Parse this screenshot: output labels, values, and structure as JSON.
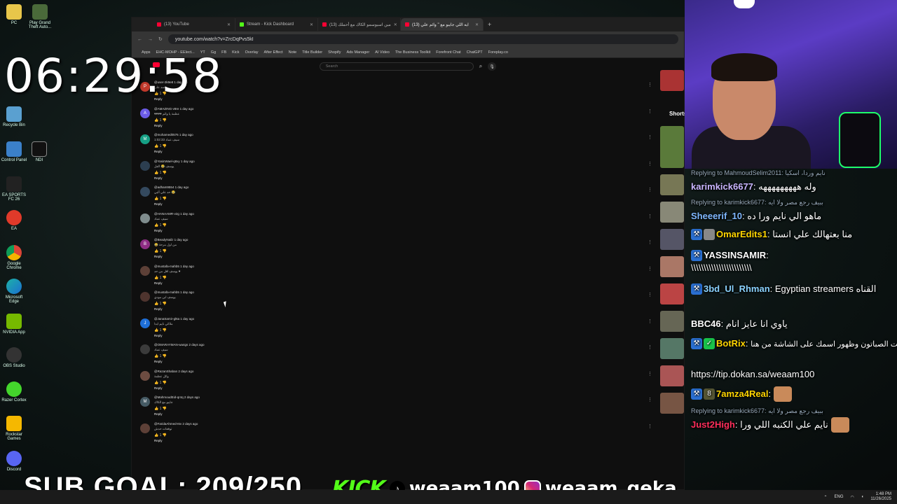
{
  "clock": "06:29:58",
  "sub_goal": "SUB GOAL: 209/250",
  "social": {
    "kick": "KICK",
    "kick_handle": "weaam100",
    "tiktok_icon": "tiktok-icon",
    "insta_handle": "weaam_geka"
  },
  "desktop_icons": [
    "PC",
    "Play Grand Theft Auto...",
    "Recycle Bin",
    "Control Panel",
    "NDI",
    "EA SPORTS FC 26",
    "EA",
    "Google Chrome",
    "Microsoft Edge",
    "NVIDIA App",
    "OBS Studio",
    "Razer Cortex",
    "Rockstar Games",
    "Discord"
  ],
  "browser": {
    "tabs": [
      {
        "label": "(13) YouTube",
        "favicon": "youtube"
      },
      {
        "label": "Stream - Kick Dashboard",
        "favicon": "kick"
      },
      {
        "label": "(13) مين اسيوسمو الكاك مع أحملك",
        "favicon": "youtube"
      },
      {
        "label": "(13) ايه اللي جايبو مع \" وائم علي",
        "favicon": "youtube"
      }
    ],
    "url": "youtube.com/watch?v=ZrcDqPvs5kI",
    "bookmarks": [
      "Apps",
      "EHC-MOHP - EElect...",
      "YT",
      "Gg",
      "FB",
      "Kick",
      "Overlay",
      "After Effect",
      "Note",
      "Title Builder",
      "Shopify",
      "Ads Manager",
      "AI Video",
      "The Business Toolkit",
      "Forefront Chat",
      "ChatGPT",
      "Foreplay.co"
    ],
    "search_placeholder": "Search",
    "shorts_label": "Shorts"
  },
  "comments": [
    {
      "avatar_color": "#c0392b",
      "initial": "P",
      "name": "@user-2k9e8 1 day ago",
      "text": "محمد علي",
      "likes": "1",
      "reply": "Reply"
    },
    {
      "avatar_color": "#6c5ce7",
      "initial": "A",
      "name": "@AMAZING-v9re 1 day ago",
      "text": "♥♥♥♥ عظمة يا وائم",
      "likes": "1",
      "reply": "Reply"
    },
    {
      "avatar_color": "#16a085",
      "initial": "M",
      "name": "@mohamed0576 1 day ago",
      "text": "سيف عماد 1:02:33",
      "likes": "1",
      "reply": "Reply"
    },
    {
      "avatar_color": "#2c3e50",
      "initial": "",
      "name": "@YasinWael-q8xy 1 day ago",
      "text": "يوسف 😂 الفل",
      "likes": "1",
      "reply": "Reply"
    },
    {
      "avatar_color": "#34495e",
      "initial": "",
      "name": "@adham9554 1 day ago",
      "text": "حد علي ألبي 😂",
      "likes": "1",
      "reply": "Reply"
    },
    {
      "avatar_color": "#7f8c8d",
      "initial": "",
      "name": "@HANAAMR-v2g 1 day ago",
      "text": "سيف عماد",
      "likes": "1",
      "reply": "Reply"
    },
    {
      "avatar_color": "#8e2d84",
      "initial": "B",
      "name": "@BeadyNailz 1 day ago",
      "text": "😂 من اول مرحة",
      "likes": "1",
      "reply": "Reply"
    },
    {
      "avatar_color": "#5d4037",
      "initial": "",
      "name": "@mustafa-mahb5 1 day ago",
      "text": "يوسف اقل من حد ♥",
      "likes": "1",
      "reply": "Reply"
    },
    {
      "avatar_color": "#4e342e",
      "initial": "",
      "name": "@mustafa-mahb5 1 day ago",
      "text": "يوسف ابن مودي",
      "likes": "1",
      "reply": "Reply"
    },
    {
      "avatar_color": "#1e6fd9",
      "initial": "J",
      "name": "@JanaSamir-gl6a 1 day ago",
      "text": "ملاكي نايم ابدا",
      "likes": "1",
      "reply": "Reply"
    },
    {
      "avatar_color": "#3b3b3b",
      "initial": "",
      "name": "@OMARAYMAN-wa4gs 2 days ago",
      "text": "سيف عماد",
      "likes": "1",
      "reply": "Reply"
    },
    {
      "avatar_color": "#6d4c41",
      "initial": "",
      "name": "@RazanShaban 2 days ago",
      "text": "وائل عظمة",
      "likes": "1",
      "reply": "Reply"
    },
    {
      "avatar_color": "#455a64",
      "initial": "M",
      "name": "@MahmoudEid-qr4q 2 days ago",
      "text": "جايبو مع الكاك",
      "likes": "1",
      "reply": "Reply"
    },
    {
      "avatar_color": "#5d4037",
      "initial": "",
      "name": "@FaridaAhmed-I6v 2 days ago",
      "text": "توقعات حدش",
      "likes": "1",
      "reply": "Reply"
    }
  ],
  "chat": [
    {
      "reply_to": "Replying to MahmoudSelim2011: نايم وردا، اسكيا",
      "user": "karimkick6677",
      "user_color": "#c9b6ff",
      "text": "وله هههههههههه"
    },
    {
      "reply_to": "Replying to karimkick6677: ببيف رجع مصر ولا ايه",
      "user": "Sheeerif_10",
      "user_color": "#7fb8ff",
      "text": "ماهو الي نايم ورا ده"
    },
    {
      "reply_to": "",
      "user": "OmarEdits1",
      "user_color": "#ffd500",
      "text": "منا بعتهالك علي انستا"
    },
    {
      "reply_to": "",
      "user": "YASSINSAMIR",
      "user_color": "#ffffff",
      "text": "\\\\\\\\\\\\\\\\\\\\\\\\\\\\\\\\\\\\\\\\\\\\\\\\"
    },
    {
      "reply_to": "",
      "user": "3bd_Ul_Rhman",
      "user_color": "#8bd3ff",
      "text": "Egyptian streamers القناه"
    },
    {
      "reply_to": "",
      "user": "BBC46",
      "user_color": "#ffffff",
      "text": "ياوي انا عايز انام"
    },
    {
      "reply_to": "",
      "user": "BotRix",
      "user_color": "#ffd500",
      "text": "لدعم وزيادة الوقت الصباتون وظهور اسمك على الشاشة من هنا :"
    },
    {
      "reply_to": "",
      "user": "",
      "user_color": "#ffffff",
      "text": "https://tip.dokan.sa/weaam100"
    },
    {
      "reply_to": "",
      "user": "7amza4Real",
      "user_color": "#ffd500",
      "text": ""
    },
    {
      "reply_to": "Replying to karimkick6677: ببيف رجع مصر ولا ايه",
      "user": "Just2High",
      "user_color": "#ff2e5b",
      "text": "نايم علي الكنبه اللي ورا"
    }
  ],
  "taskbar": {
    "lang": "ENG",
    "time": "1:48 PM",
    "date": "11/26/2025"
  }
}
